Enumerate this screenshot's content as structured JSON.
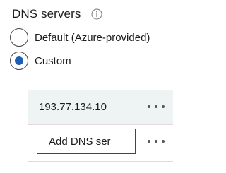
{
  "header": {
    "title": "DNS servers",
    "info_icon": "info-icon"
  },
  "dns_options": [
    {
      "label": "Default (Azure-provided)",
      "selected": false
    },
    {
      "label": "Custom",
      "selected": true
    }
  ],
  "servers": [
    {
      "address": "193.77.134.10"
    }
  ],
  "new_server": {
    "placeholder": "Add DNS ser",
    "value": ""
  },
  "icons": {
    "more": "more-options-icon",
    "info": "info-icon",
    "radio": "radio-button"
  },
  "colors": {
    "accent": "#1a5fb4",
    "row_background": "#eef4f4",
    "row_separator": "#e6d6e0"
  }
}
